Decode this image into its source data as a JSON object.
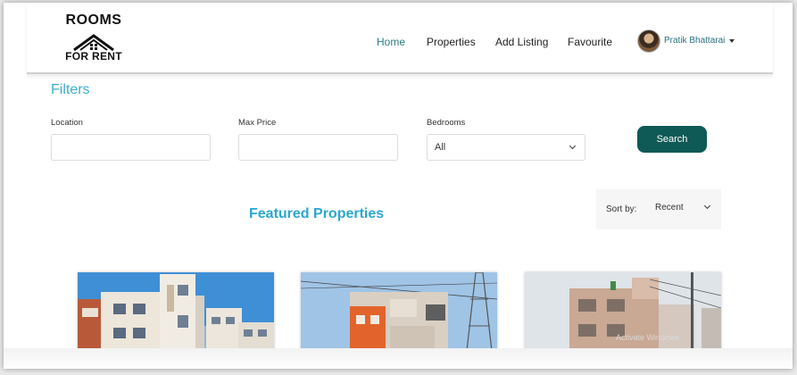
{
  "brand": {
    "line1": "ROOMS",
    "line2": "FOR RENT"
  },
  "nav": {
    "items": [
      {
        "label": "Home",
        "active": true
      },
      {
        "label": "Properties",
        "active": false
      },
      {
        "label": "Add Listing",
        "active": false
      },
      {
        "label": "Favourite",
        "active": false
      }
    ],
    "user_name": "Pratik Bhattarai"
  },
  "filters": {
    "title": "Filters",
    "location_label": "Location",
    "location_value": "",
    "max_price_label": "Max Price",
    "max_price_value": "",
    "bedrooms_label": "Bedrooms",
    "bedrooms_value": "All",
    "search_label": "Search"
  },
  "featured": {
    "title": "Featured Properties",
    "sort_label": "Sort by:",
    "sort_value": "Recent"
  },
  "colors": {
    "accent": "#2ba7cf",
    "button": "#0f5a56",
    "nav_active": "#2a7f7f"
  },
  "watermark": "Activate Windows"
}
